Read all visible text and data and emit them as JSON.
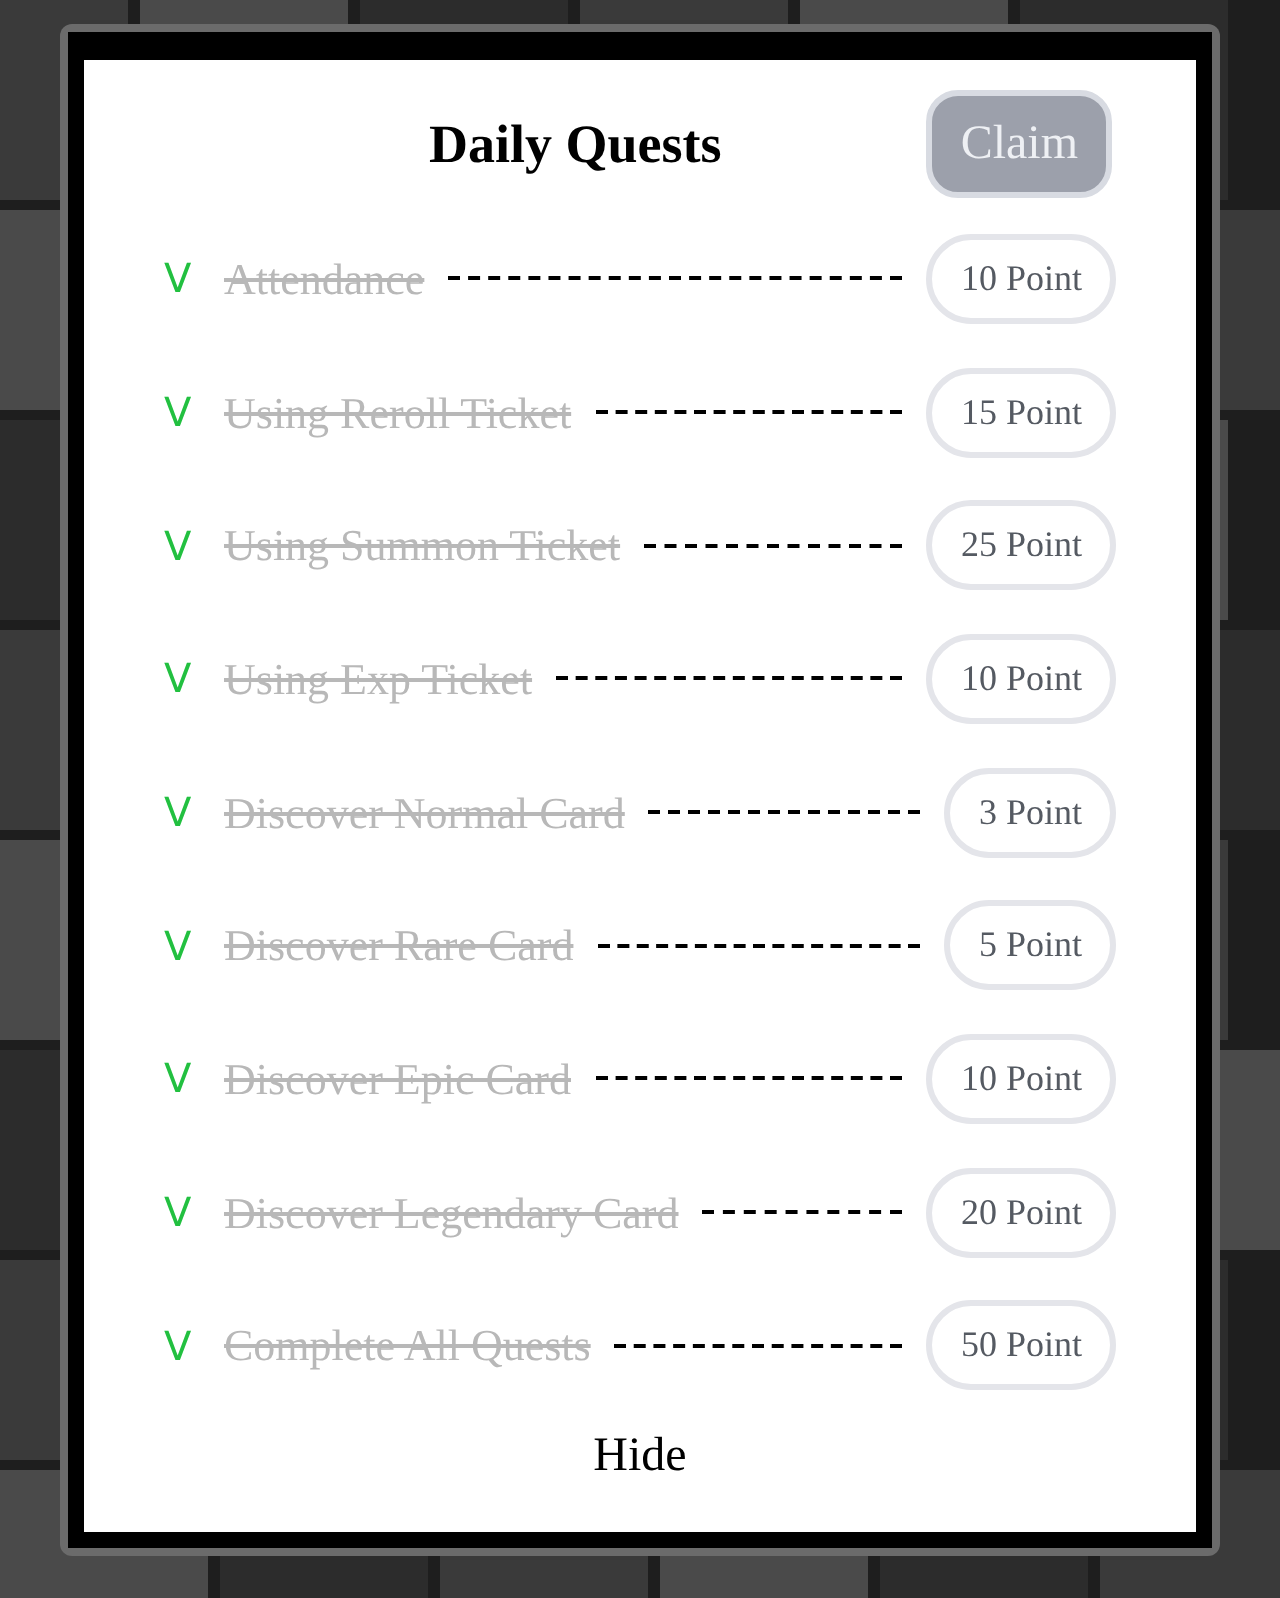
{
  "title": "Daily Quests",
  "claim": {
    "label": "Claim",
    "disabled": true
  },
  "quests": [
    {
      "mark": "V",
      "name": "Attendance",
      "done": true,
      "points": "10 Point"
    },
    {
      "mark": "V",
      "name": "Using Reroll Ticket",
      "done": true,
      "points": "15 Point"
    },
    {
      "mark": "V",
      "name": "Using Summon Ticket",
      "done": true,
      "points": "25 Point"
    },
    {
      "mark": "V",
      "name": "Using Exp Ticket",
      "done": true,
      "points": "10 Point"
    },
    {
      "mark": "V",
      "name": "Discover Normal Card",
      "done": true,
      "points": "3 Point"
    },
    {
      "mark": "V",
      "name": "Discover Rare Card",
      "done": true,
      "points": "5 Point"
    },
    {
      "mark": "V",
      "name": "Discover Epic Card",
      "done": true,
      "points": "10 Point"
    },
    {
      "mark": "V",
      "name": "Discover Legendary Card",
      "done": true,
      "points": "20 Point"
    },
    {
      "mark": "V",
      "name": "Complete All Quests",
      "done": true,
      "points": "50 Point"
    }
  ],
  "hide": "Hide"
}
